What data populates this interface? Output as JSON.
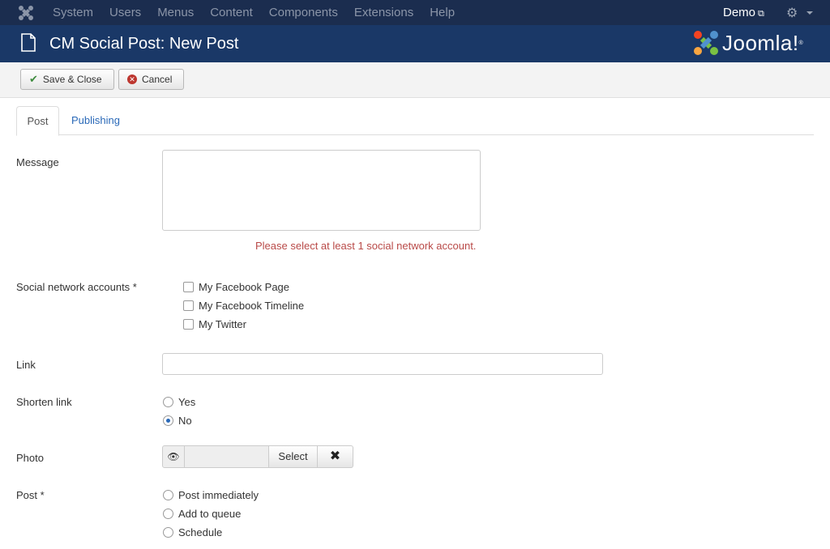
{
  "topnav": {
    "menu": [
      "System",
      "Users",
      "Menus",
      "Content",
      "Components",
      "Extensions",
      "Help"
    ],
    "user": "Demo",
    "icons": {
      "logo": "joomla-logo-icon",
      "external": "external-link-icon",
      "settings": "gear-icon"
    }
  },
  "titlebar": {
    "title": "CM Social Post: New Post",
    "brand": "Joomla!",
    "icon": "document-icon"
  },
  "toolbar": {
    "save_label": "Save & Close",
    "cancel_label": "Cancel"
  },
  "tabs": [
    {
      "label": "Post",
      "active": true
    },
    {
      "label": "Publishing",
      "active": false
    }
  ],
  "form": {
    "message_label": "Message",
    "message_value": "",
    "message_error": "Please select at least 1 social network account.",
    "accounts_label": "Social network accounts *",
    "accounts": [
      {
        "label": "My Facebook Page",
        "checked": false
      },
      {
        "label": "My Facebook Timeline",
        "checked": false
      },
      {
        "label": "My Twitter",
        "checked": false
      }
    ],
    "link_label": "Link",
    "link_value": "",
    "shorten_label": "Shorten link",
    "shorten_options": [
      {
        "label": "Yes",
        "checked": false
      },
      {
        "label": "No",
        "checked": true
      }
    ],
    "photo_label": "Photo",
    "photo_select": "Select",
    "photo_clear": "✖",
    "post_label": "Post *",
    "post_options": [
      {
        "label": "Post immediately",
        "checked": false
      },
      {
        "label": "Add to queue",
        "checked": false
      },
      {
        "label": "Schedule",
        "checked": false
      }
    ]
  },
  "colors": {
    "topnav_bg": "#1b2d4f",
    "titlebar_bg": "#1a3867",
    "error": "#b94a48",
    "link": "#2a69b8"
  }
}
